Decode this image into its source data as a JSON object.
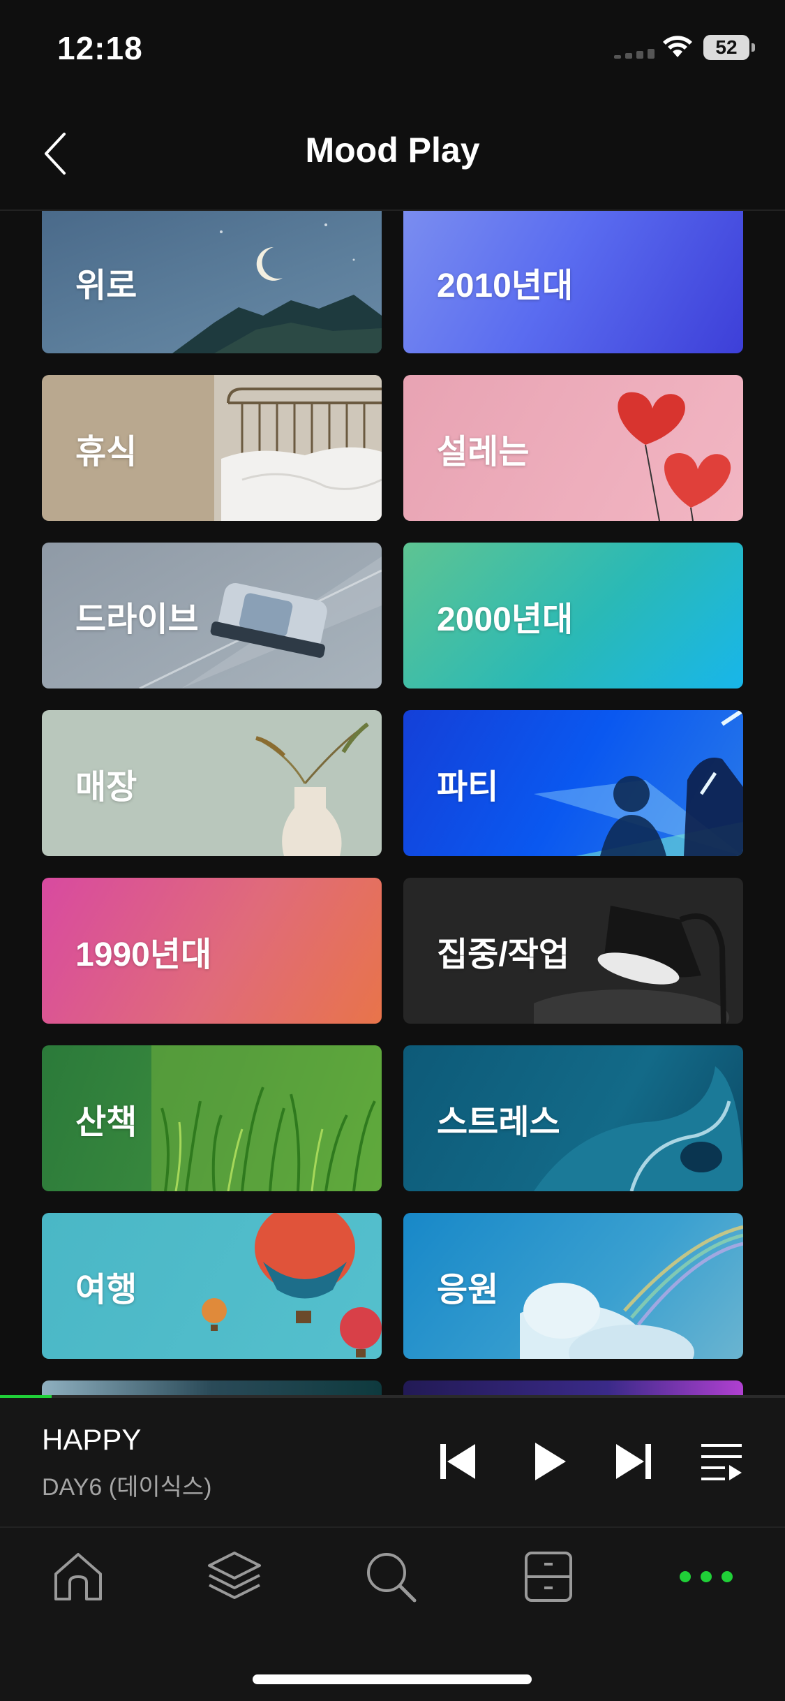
{
  "status_bar": {
    "time": "12:18",
    "battery": "52"
  },
  "header": {
    "title": "Mood Play"
  },
  "moods": [
    {
      "label": "위로"
    },
    {
      "label": "2010년대"
    },
    {
      "label": "휴식"
    },
    {
      "label": "설레는"
    },
    {
      "label": "드라이브"
    },
    {
      "label": "2000년대"
    },
    {
      "label": "매장"
    },
    {
      "label": "파티"
    },
    {
      "label": "1990년대"
    },
    {
      "label": "집중/작업"
    },
    {
      "label": "산책"
    },
    {
      "label": "스트레스"
    },
    {
      "label": "여행"
    },
    {
      "label": "응원"
    }
  ],
  "player": {
    "song": "HAPPY",
    "artist": "DAY6 (데이식스)",
    "progress": 0.066
  },
  "nav": {
    "items": [
      "home-icon",
      "library-icon",
      "search-icon",
      "storage-icon",
      "more-icon"
    ],
    "active_color": "#20d038"
  }
}
